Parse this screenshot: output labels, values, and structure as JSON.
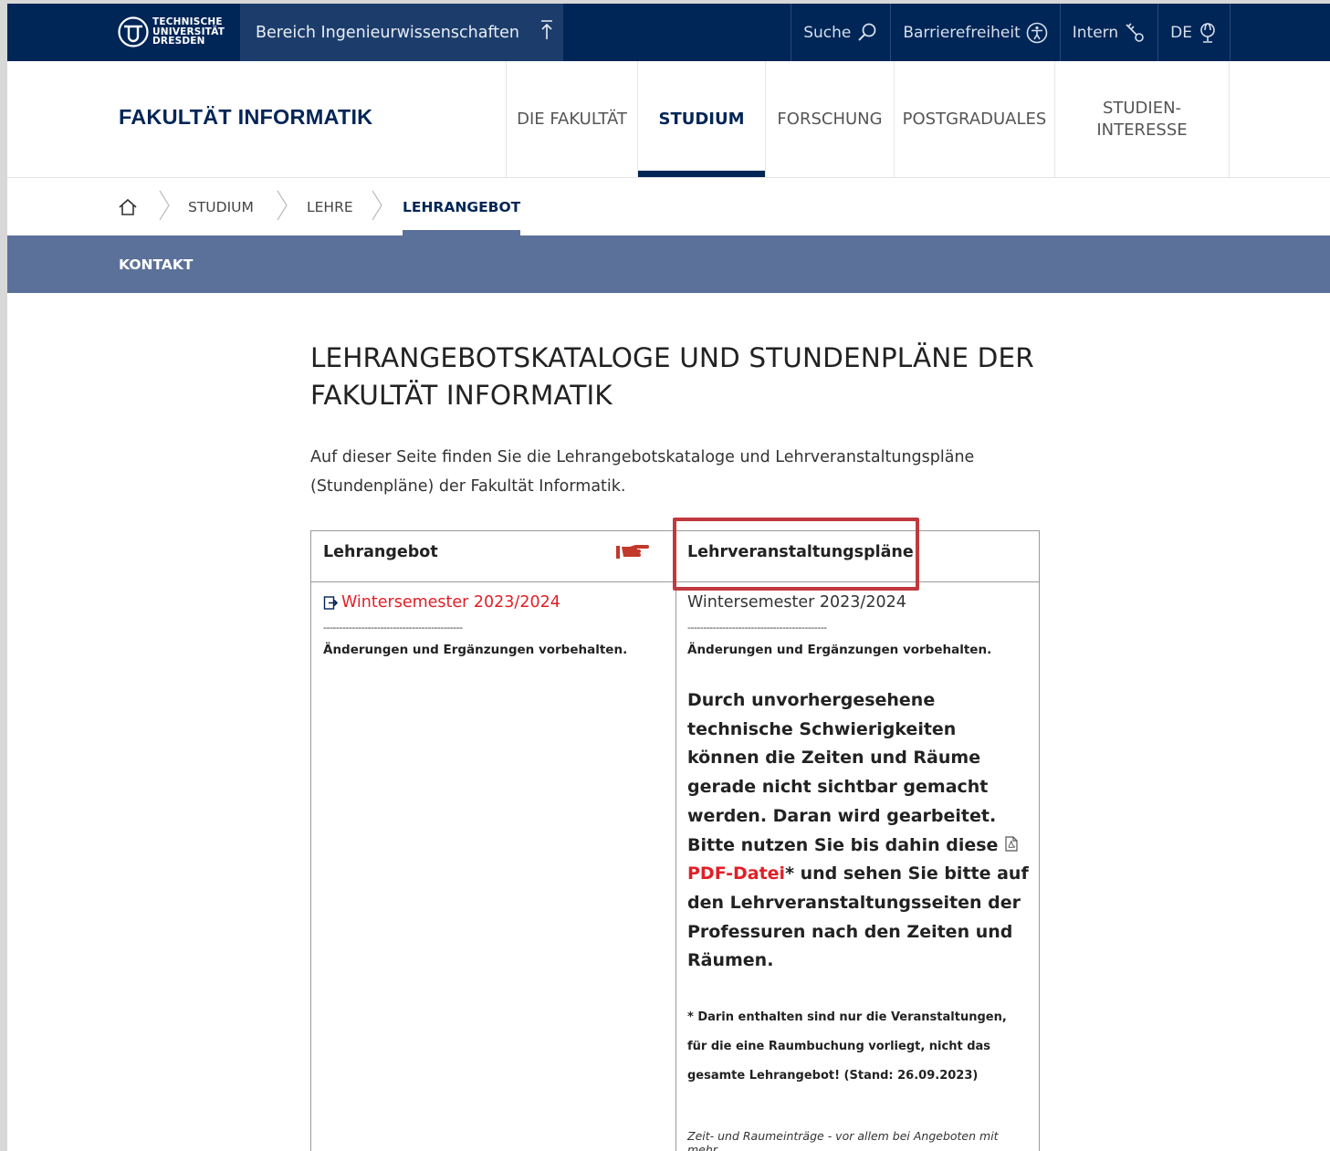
{
  "topbar": {
    "logo_lines": [
      "TECHNISCHE",
      "UNIVERSITÄT",
      "DRESDEN"
    ],
    "bereich": "Bereich Ingenieurwissenschaften",
    "links": [
      "Suche",
      "Barrierefreiheit",
      "Intern",
      "DE"
    ]
  },
  "header": {
    "title": "FAKULTÄT INFORMATIK",
    "nav": [
      "DIE FAKULTÄT",
      "STUDIUM",
      "FORSCHUNG",
      "POSTGRADUALES",
      "STUDIEN-",
      "INTERESSE"
    ]
  },
  "breadcrumb": [
    "STUDIUM",
    "LEHRE",
    "LEHRANGEBOT"
  ],
  "subnav": {
    "item": "KONTAKT"
  },
  "content": {
    "title_line1": "LEHRANGEBOTSKATALOGE UND STUNDENPLÄNE DER",
    "title_line2": "FAKULTÄT INFORMATIK",
    "intro_line1": "Auf dieser Seite finden Sie die Lehrangebotskataloge und Lehrveranstaltungspläne",
    "intro_line2": "(Stundenpläne) der Fakultät Informatik."
  },
  "table": {
    "col1_header": "Lehrangebot",
    "col2_header": "Lehrveranstaltungspläne",
    "left": {
      "semester": "Wintersemester 2023/2024",
      "dashes": "--------------------------------------------",
      "note": "Änderungen und Ergänzungen vorbehalten."
    },
    "right": {
      "semester": "Wintersemester 2023/2024",
      "dashes": "--------------------------------------------",
      "note": "Änderungen und Ergänzungen vorbehalten.",
      "warning_pre": "Durch unvorhergesehene technische Schwierigkeiten können die Zeiten und Räume gerade nicht sichtbar gemacht werden. Daran wird gearbeitet. Bitte nutzen Sie bis dahin diese ",
      "pdf_link": "PDF-Datei",
      "warning_post": "* und sehen Sie bitte auf den Lehrveranstaltungsseiten der Professuren nach den Zeiten und Räumen.",
      "footnote": "* Darin enthalten sind nur die Veranstaltungen, für die eine Raumbuchung vorliegt, nicht das gesamte Lehrangebot! (Stand: 26.09.2023)",
      "italic": "Zeit- und Raumeinträge - vor allem bei Angeboten mit mehr"
    }
  },
  "colors": {
    "navy": "#002557",
    "accent_red": "#e11f26",
    "subnav": "#5c7199",
    "highlight": "#c0393e"
  }
}
